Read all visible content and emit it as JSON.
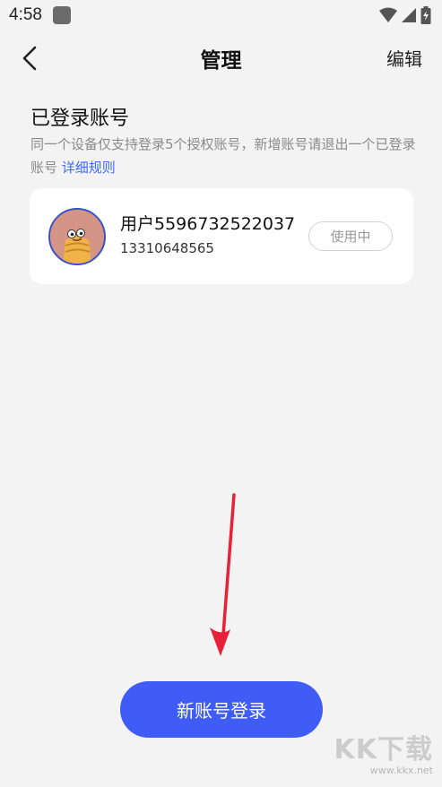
{
  "status_bar": {
    "time": "4:58",
    "icons": [
      "app-notification-icon",
      "wifi-icon",
      "cell-signal-icon",
      "battery-charging-icon"
    ]
  },
  "header": {
    "back_icon": "chevron-left-icon",
    "title": "管理",
    "edit_label": "编辑"
  },
  "section": {
    "title": "已登录账号",
    "description": "同一个设备仅支持登录5个授权账号，新增账号请退出一个已登录账号",
    "rules_link": "详细规则"
  },
  "account": {
    "avatar_icon": "cartoon-character-avatar",
    "name": "用户5596732522037",
    "phone": "13310648565",
    "status": "使用中"
  },
  "actions": {
    "new_login": "新账号登录"
  },
  "watermark": {
    "main": "KK下载",
    "url": "www.kkx.net"
  },
  "colors": {
    "accent": "#3f5cf6",
    "link": "#3b6cf5",
    "background": "#f3f3f4",
    "annotation_arrow": "#e8213a"
  }
}
